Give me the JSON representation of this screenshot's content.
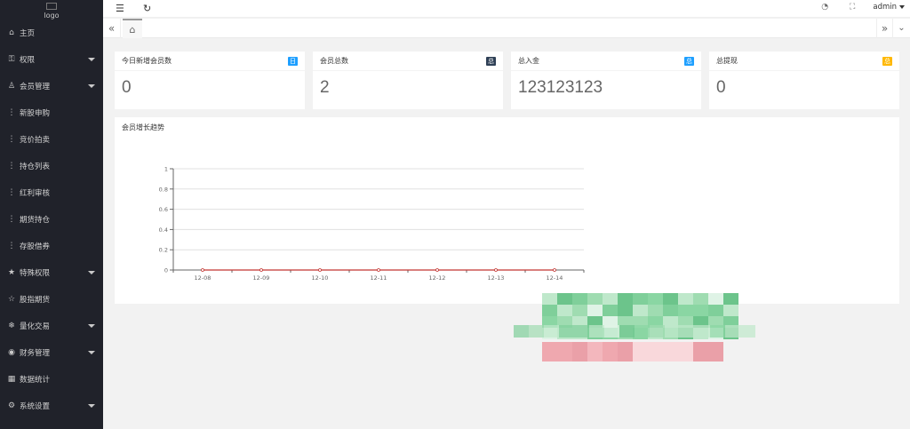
{
  "sidebar": {
    "logo_alt": "logo",
    "items": [
      {
        "label": "主页",
        "icon": "home-icon",
        "has_caret": false
      },
      {
        "label": "权限",
        "icon": "lock-icon",
        "has_caret": true
      },
      {
        "label": "会员管理",
        "icon": "user-icon",
        "has_caret": true
      },
      {
        "label": "新股申购",
        "icon": "dots-icon",
        "has_caret": false
      },
      {
        "label": "竞价拍卖",
        "icon": "dots-icon",
        "has_caret": false
      },
      {
        "label": "持仓列表",
        "icon": "dots-icon",
        "has_caret": false
      },
      {
        "label": "红利审核",
        "icon": "dots-icon",
        "has_caret": false
      },
      {
        "label": "期货持仓",
        "icon": "dots-icon",
        "has_caret": false
      },
      {
        "label": "存股借券",
        "icon": "dots-icon",
        "has_caret": false
      },
      {
        "label": "特殊权限",
        "icon": "star-icon",
        "has_caret": true
      },
      {
        "label": "股指期货",
        "icon": "star-outline-icon",
        "has_caret": false
      },
      {
        "label": "量化交易",
        "icon": "snowflake-icon",
        "has_caret": true
      },
      {
        "label": "财务管理",
        "icon": "circle-dot-icon",
        "has_caret": true
      },
      {
        "label": "数据统计",
        "icon": "calendar-icon",
        "has_caret": false
      },
      {
        "label": "系统设置",
        "icon": "gear-icon",
        "has_caret": true
      }
    ]
  },
  "topbar": {
    "user": "admin",
    "collapse_icon": "menu-collapse-icon",
    "refresh_icon": "refresh-icon",
    "theme_icon": "palette-icon",
    "fullscreen_icon": "fullscreen-icon"
  },
  "cards": [
    {
      "title": "今日新增会员数",
      "badge": "日",
      "badge_color": "#1e9fff",
      "value": "0"
    },
    {
      "title": "会员总数",
      "badge": "总",
      "badge_color": "#2f4056",
      "value": "2"
    },
    {
      "title": "总入金",
      "badge": "总",
      "badge_color": "#1e9fff",
      "value": "123123123"
    },
    {
      "title": "总提现",
      "badge": "总",
      "badge_color": "#ffb800",
      "value": "0"
    }
  ],
  "chart_title": "会员增长趋势",
  "chart_data": {
    "type": "line",
    "title": "会员增长趋势",
    "categories": [
      "12-08",
      "12-09",
      "12-10",
      "12-11",
      "12-12",
      "12-13",
      "12-14"
    ],
    "series": [
      {
        "values": [
          0,
          0,
          0,
          0,
          0,
          0,
          0
        ],
        "color": "#c23531"
      }
    ],
    "yticks": [
      "0",
      "0.2",
      "0.4",
      "0.6",
      "0.8",
      "1"
    ],
    "ylim": [
      0,
      1
    ],
    "grid": true
  }
}
